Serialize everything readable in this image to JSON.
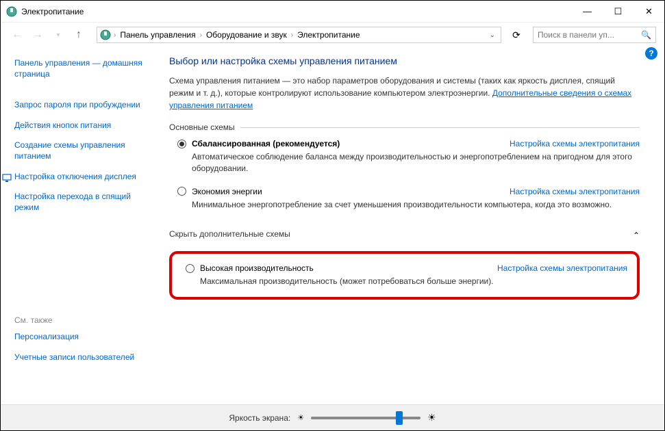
{
  "window": {
    "title": "Электропитание"
  },
  "titlebar_ctrls": {
    "min": "—",
    "max": "☐",
    "close": "✕"
  },
  "nav": {
    "breadcrumb": [
      "Панель управления",
      "Оборудование и звук",
      "Электропитание"
    ],
    "search_placeholder": "Поиск в панели уп..."
  },
  "sidebar": {
    "home": "Панель управления — домашняя страница",
    "links": [
      "Запрос пароля при пробуждении",
      "Действия кнопок питания",
      "Создание схемы управления питанием",
      "Настройка отключения дисплея",
      "Настройка перехода в спящий режим"
    ],
    "see_also_label": "См. также",
    "see_also": [
      "Персонализация",
      "Учетные записи пользователей"
    ]
  },
  "content": {
    "heading": "Выбор или настройка схемы управления питанием",
    "desc": "Схема управления питанием — это набор параметров оборудования и системы (таких как яркость дисплея, спящий режим и т. д.), которые контролируют использование компьютером электроэнергии. ",
    "desc_link": "Дополнительные сведения о схемах управления питанием",
    "group1": "Основные схемы",
    "plan1": {
      "name": "Сбалансированная (рекомендуется)",
      "link": "Настройка схемы электропитания",
      "desc": "Автоматическое соблюдение баланса между производительностью и энергопотреблением на пригодном для этого оборудовании."
    },
    "plan2": {
      "name": "Экономия энергии",
      "link": "Настройка схемы электропитания",
      "desc": "Минимальное энергопотребление за счет уменьшения производительности компьютера, когда это возможно."
    },
    "group2": "Скрыть дополнительные схемы",
    "plan3": {
      "name": "Высокая производительность",
      "link": "Настройка схемы электропитания",
      "desc": "Максимальная производительность (может потребоваться больше энергии)."
    }
  },
  "footer": {
    "brightness_label": "Яркость экрана:"
  }
}
